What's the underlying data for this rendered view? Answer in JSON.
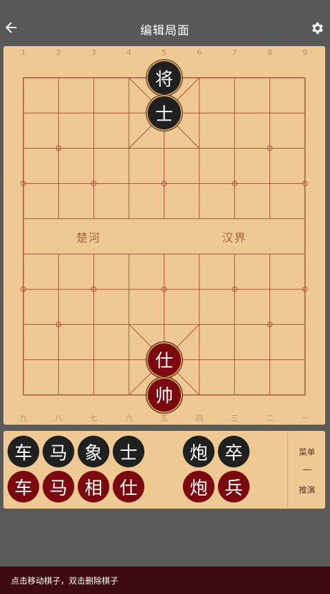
{
  "header": {
    "title": "编辑局面",
    "back_icon": "arrow-left-icon",
    "settings_icon": "gear-icon"
  },
  "board": {
    "top_numbers": [
      "1",
      "2",
      "3",
      "4",
      "5",
      "6",
      "7",
      "8",
      "9"
    ],
    "bottom_numbers": [
      "九",
      "八",
      "七",
      "六",
      "五",
      "四",
      "三",
      "二",
      "一"
    ],
    "river_left": "楚河",
    "river_right": "汉界",
    "pieces": [
      {
        "label": "将",
        "color": "black",
        "file": 5,
        "rank": 0
      },
      {
        "label": "士",
        "color": "black",
        "file": 5,
        "rank": 1
      },
      {
        "label": "仕",
        "color": "red",
        "file": 5,
        "rank": 8
      },
      {
        "label": "帅",
        "color": "red",
        "file": 5,
        "rank": 9
      }
    ]
  },
  "palette": {
    "black_row": [
      "车",
      "马",
      "象",
      "士",
      "炮",
      "卒"
    ],
    "red_row": [
      "车",
      "马",
      "相",
      "仕",
      "炮",
      "兵"
    ],
    "menu_label": "菜单",
    "separator": "—",
    "analyze_label": "推演"
  },
  "status_bar": {
    "hint": "点击移动棋子，双击删除棋子"
  },
  "colors": {
    "board": "#efc994",
    "line": "#a8503c",
    "black_piece": "#202020",
    "red_piece": "#7a0a10",
    "status_bar": "#3e0c10",
    "background": "#5a5a5a"
  }
}
